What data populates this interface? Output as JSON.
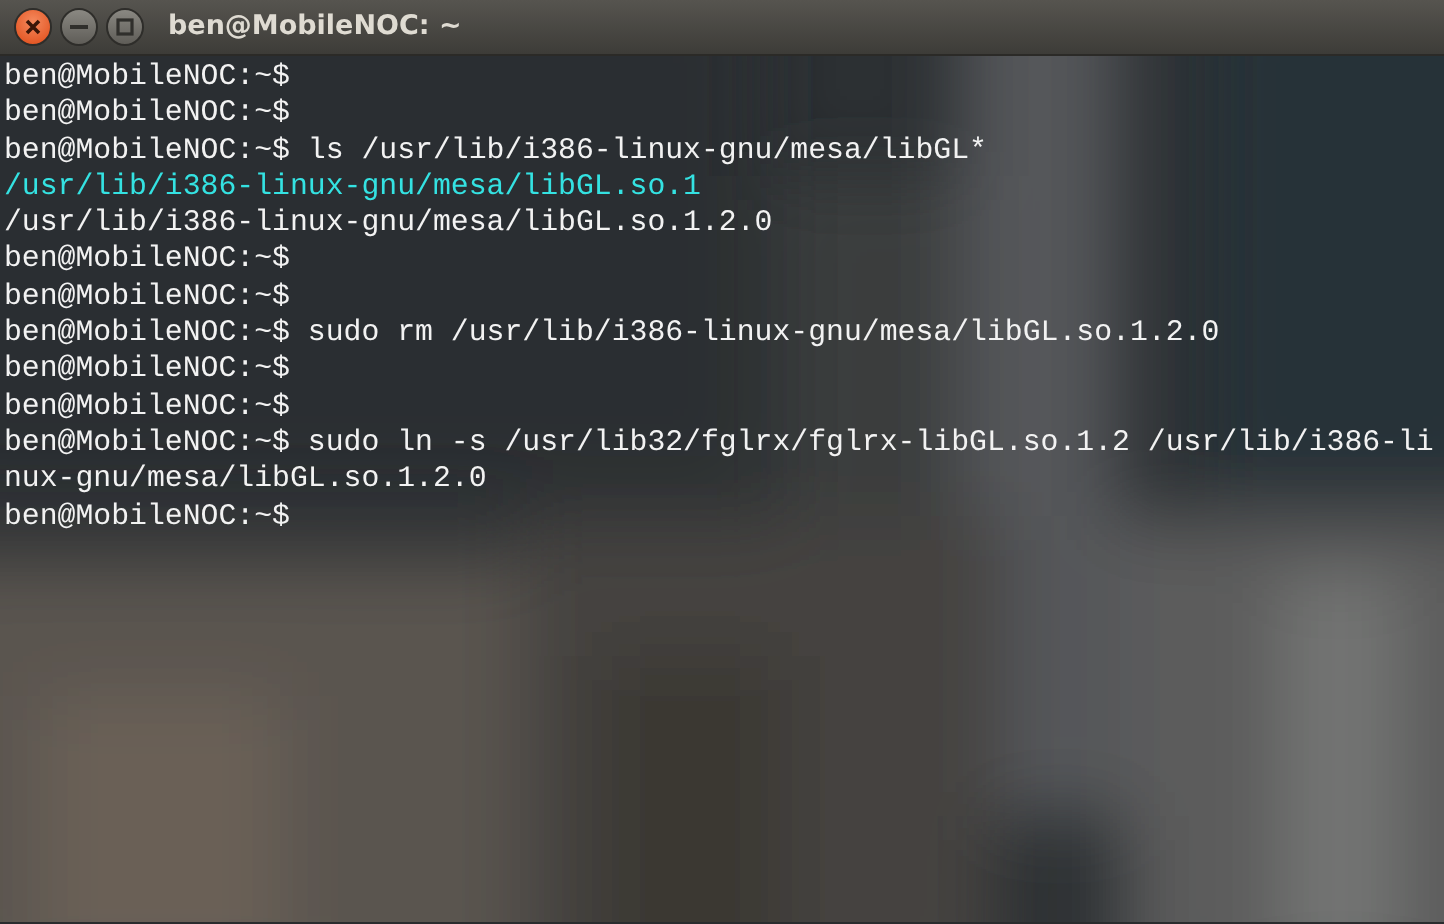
{
  "window": {
    "title": "ben@MobileNOC: ~"
  },
  "lines": [
    {
      "kind": "text",
      "text": "ben@MobileNOC:~$"
    },
    {
      "kind": "text",
      "text": "ben@MobileNOC:~$"
    },
    {
      "kind": "text",
      "text": "ben@MobileNOC:~$ ls /usr/lib/i386-linux-gnu/mesa/libGL*"
    },
    {
      "kind": "symlink",
      "text": "/usr/lib/i386-linux-gnu/mesa/libGL.so.1"
    },
    {
      "kind": "text",
      "text": "/usr/lib/i386-linux-gnu/mesa/libGL.so.1.2.0"
    },
    {
      "kind": "text",
      "text": "ben@MobileNOC:~$"
    },
    {
      "kind": "text",
      "text": "ben@MobileNOC:~$"
    },
    {
      "kind": "text",
      "text": "ben@MobileNOC:~$ sudo rm /usr/lib/i386-linux-gnu/mesa/libGL.so.1.2.0"
    },
    {
      "kind": "text",
      "text": "ben@MobileNOC:~$"
    },
    {
      "kind": "text",
      "text": "ben@MobileNOC:~$"
    },
    {
      "kind": "text",
      "text": "ben@MobileNOC:~$ sudo ln -s /usr/lib32/fglrx/fglrx-libGL.so.1.2 /usr/lib/i386-li"
    },
    {
      "kind": "text",
      "text": "nux-gnu/mesa/libGL.so.1.2.0"
    },
    {
      "kind": "text",
      "text": "ben@MobileNOC:~$"
    }
  ]
}
